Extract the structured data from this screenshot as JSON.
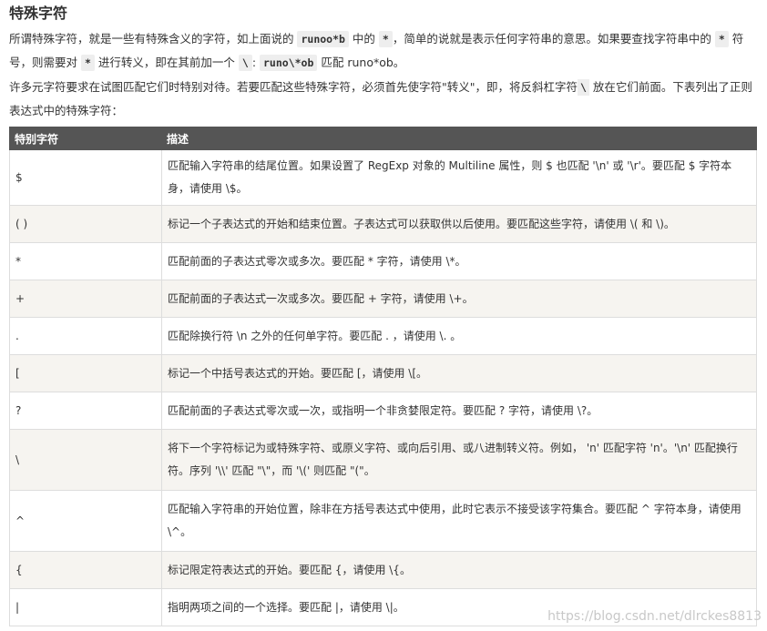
{
  "heading": "特殊字符",
  "para1": {
    "t1": "所谓特殊字符，就是一些有特殊含义的字符，如上面说的 ",
    "c1": "runoo*b",
    "t2": " 中的 ",
    "c2": "*",
    "t3": "，简单的说就是表示任何字符串的意思。如果要查找字符串中的 ",
    "c3": "*",
    "t4": " 符号，则需要对 ",
    "c4": "*",
    "t5": " 进行转义，即在其前加一个 ",
    "c5": "\\",
    "t6": ": ",
    "c6": "runo\\*ob",
    "t7": " 匹配 runo*ob。"
  },
  "para2": {
    "t1": "许多元字符要求在试图匹配它们时特别对待。若要匹配这些特殊字符，必须首先使字符\"转义\"，即，将反斜杠字符",
    "c1": "\\",
    "t2": " 放在它们前面。下表列出了正则表达式中的特殊字符："
  },
  "table": {
    "headers": [
      "特别字符",
      "描述"
    ],
    "rows": [
      {
        "char": "$",
        "desc": "匹配输入字符串的结尾位置。如果设置了 RegExp 对象的 Multiline 属性，则 $ 也匹配 '\\n' 或 '\\r'。要匹配 $ 字符本身，请使用 \\$。"
      },
      {
        "char": "( )",
        "desc": "标记一个子表达式的开始和结束位置。子表达式可以获取供以后使用。要匹配这些字符，请使用 \\( 和 \\)。"
      },
      {
        "char": "*",
        "desc": "匹配前面的子表达式零次或多次。要匹配 * 字符，请使用 \\*。"
      },
      {
        "char": "+",
        "desc": "匹配前面的子表达式一次或多次。要匹配 + 字符，请使用 \\+。"
      },
      {
        "char": ".",
        "desc": "匹配除换行符 \\n 之外的任何单字符。要匹配 . ，请使用 \\. 。"
      },
      {
        "char": "[",
        "desc": "标记一个中括号表达式的开始。要匹配 [，请使用 \\[。"
      },
      {
        "char": "?",
        "desc": "匹配前面的子表达式零次或一次，或指明一个非贪婪限定符。要匹配 ? 字符，请使用 \\?。"
      },
      {
        "char": "\\",
        "desc": "将下一个字符标记为或特殊字符、或原义字符、或向后引用、或八进制转义符。例如， 'n' 匹配字符 'n'。'\\n' 匹配换行符。序列 '\\\\' 匹配 \"\\\"，而 '\\(' 则匹配 \"(\"。"
      },
      {
        "char": "^",
        "desc": "匹配输入字符串的开始位置，除非在方括号表达式中使用，此时它表示不接受该字符集合。要匹配 ^ 字符本身，请使用 \\^。"
      },
      {
        "char": "{",
        "desc": "标记限定符表达式的开始。要匹配 {，请使用 \\{。"
      },
      {
        "char": "|",
        "desc": "指明两项之间的一个选择。要匹配 |，请使用 \\|。"
      }
    ]
  },
  "watermark": "https://blog.csdn.net/dlrckes8813"
}
